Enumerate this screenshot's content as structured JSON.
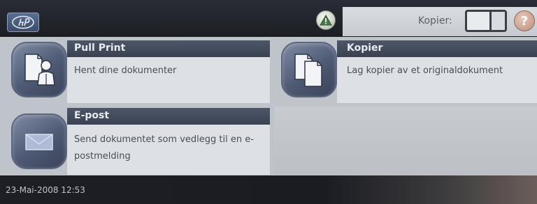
{
  "header": {
    "copies_label": "Kopier:",
    "copies_value": "",
    "help_label": "?"
  },
  "tiles": [
    {
      "title": "Pull Print",
      "description": "Hent dine dokumenter",
      "icon": "person-document-icon"
    },
    {
      "title": "Kopier",
      "description": "Lag kopier av et originaldokument",
      "icon": "copy-documents-icon"
    },
    {
      "title": "E-post",
      "description": "Send dokumentet som vedlegg til en e-postmelding",
      "icon": "envelope-icon"
    }
  ],
  "status_bar": {
    "datetime": "23-Mai-2008  12:53"
  },
  "colors": {
    "title_bar": "#3a4252",
    "tile_body": "#dde0e4",
    "icon_bg": "#4e5973",
    "topbar": "#1c1e24"
  }
}
